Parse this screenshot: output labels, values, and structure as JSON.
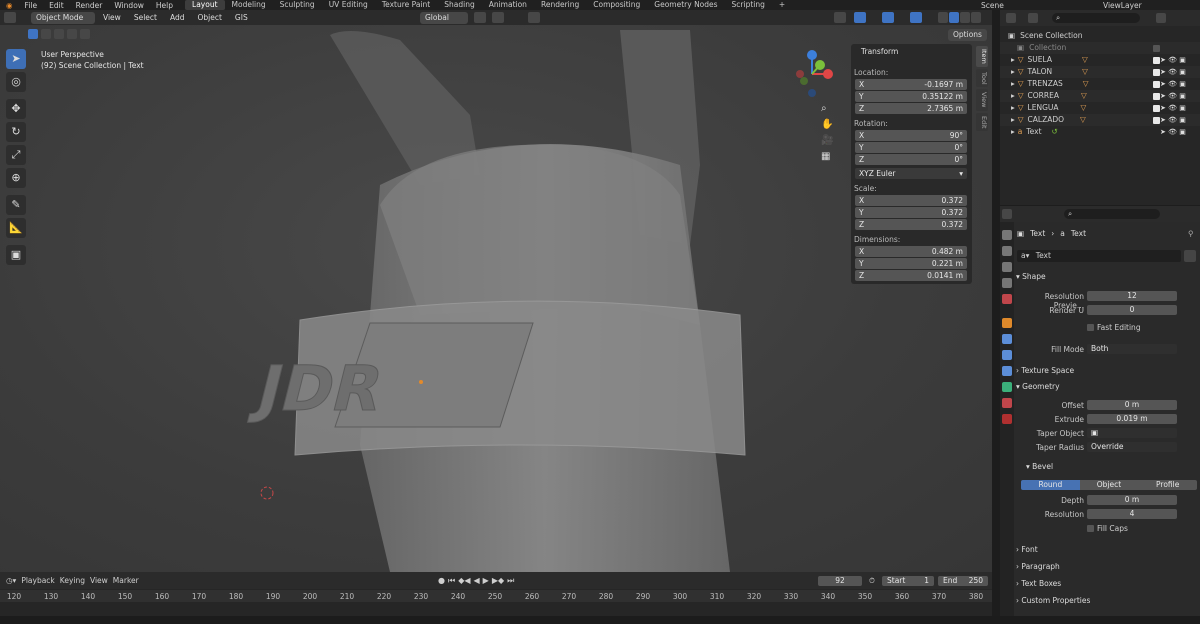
{
  "menu": [
    "File",
    "Edit",
    "Render",
    "Window",
    "Help"
  ],
  "workspaces": [
    "Layout",
    "Modeling",
    "Sculpting",
    "UV Editing",
    "Texture Paint",
    "Shading",
    "Animation",
    "Rendering",
    "Compositing",
    "Geometry Nodes",
    "Scripting",
    "+"
  ],
  "active_workspace": "Layout",
  "scene": {
    "label": "Scene",
    "viewlayer": "ViewLayer"
  },
  "header": {
    "mode": "Object Mode",
    "items": [
      "View",
      "Select",
      "Add",
      "Object",
      "GIS"
    ],
    "orientation": "Global",
    "options": "Options"
  },
  "viewport": {
    "overlay_line1": "User Perspective",
    "overlay_line2": "(92) Scene Collection | Text"
  },
  "transform_panel": {
    "title": "Transform",
    "location_label": "Location:",
    "location": [
      {
        "axis": "X",
        "value": "-0.1697 m"
      },
      {
        "axis": "Y",
        "value": "0.35122 m"
      },
      {
        "axis": "Z",
        "value": "2.7365 m"
      }
    ],
    "rotation_label": "Rotation:",
    "rotation": [
      {
        "axis": "X",
        "value": "90°"
      },
      {
        "axis": "Y",
        "value": "0°"
      },
      {
        "axis": "Z",
        "value": "0°"
      }
    ],
    "rotation_mode": "XYZ Euler",
    "scale_label": "Scale:",
    "scale": [
      {
        "axis": "X",
        "value": "0.372"
      },
      {
        "axis": "Y",
        "value": "0.372"
      },
      {
        "axis": "Z",
        "value": "0.372"
      }
    ],
    "dimensions_label": "Dimensions:",
    "dimensions": [
      {
        "axis": "X",
        "value": "0.482 m"
      },
      {
        "axis": "Y",
        "value": "0.221 m"
      },
      {
        "axis": "Z",
        "value": "0.0141 m"
      }
    ]
  },
  "sidebar_tabs": [
    "Item",
    "Tool",
    "View",
    "Edit"
  ],
  "outliner": {
    "root": "Scene Collection",
    "collection": "Collection",
    "items": [
      "SUELA",
      "TALON",
      "TRENZAS",
      "CORREA",
      "LENGUA",
      "CALZADO",
      "Text"
    ]
  },
  "properties": {
    "breadcrumb_object": "Text",
    "breadcrumb_data": "Text",
    "datablock": "Text",
    "shape_section": "Shape",
    "resolution_preview_label": "Resolution Previe...",
    "resolution_preview": "12",
    "render_u_label": "Render U",
    "render_u": "0",
    "fast_editing": "Fast Editing",
    "fill_mode_label": "Fill Mode",
    "fill_mode": "Both",
    "texture_space": "Texture Space",
    "geometry_section": "Geometry",
    "offset_label": "Offset",
    "offset": "0 m",
    "extrude_label": "Extrude",
    "extrude": "0.019 m",
    "taper_object_label": "Taper Object",
    "taper_radius_label": "Taper Radius",
    "taper_radius": "Override",
    "bevel_section": "Bevel",
    "bevel_modes": [
      "Round",
      "Object",
      "Profile"
    ],
    "depth_label": "Depth",
    "depth": "0 m",
    "resolution_label": "Resolution",
    "resolution": "4",
    "fill_caps": "Fill Caps",
    "collapsed": [
      "Font",
      "Paragraph",
      "Text Boxes",
      "Custom Properties"
    ]
  },
  "timeline": {
    "items": [
      "Playback",
      "Keying",
      "View",
      "Marker"
    ],
    "current_frame": "92",
    "start_label": "Start",
    "start": "1",
    "end_label": "End",
    "end": "250",
    "ruler": [
      "120",
      "130",
      "140",
      "150",
      "160",
      "170",
      "180",
      "190",
      "200",
      "210",
      "220",
      "230",
      "240",
      "250",
      "260",
      "270",
      "280",
      "290",
      "300",
      "310",
      "320",
      "330",
      "340",
      "350",
      "360",
      "370",
      "380"
    ]
  },
  "viewport_text": "JDR",
  "colors": {
    "accent": "#3f74c4",
    "x_axis": "#e04646",
    "y_axis": "#7bbf3b",
    "z_axis": "#3c7fdc",
    "text_object": "#e3a054"
  }
}
